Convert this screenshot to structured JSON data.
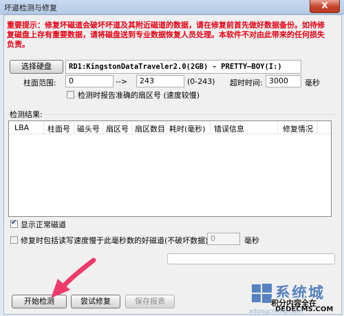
{
  "window": {
    "title": "坏道检测与修复",
    "close_label": "X"
  },
  "warning": "重要提示：修复坏磁道会破坏坏道及其附近磁道的数据，请在修复前首先做好数据备份。如待修复磁盘上存有重要数据，请将磁盘送到专业数据恢复人员处理。本软件不对由此带来的任何损失负责。",
  "disk": {
    "select_label": "选择硬盘",
    "selected": "RD1:KingstonDataTraveler2.0(2GB) - PRETTY—BOY(I:)"
  },
  "range": {
    "label": "柱面范围:",
    "from": "0",
    "arrow": "-->",
    "to": "243",
    "hint": "(0-243)"
  },
  "timeout": {
    "label": "超时时间:",
    "value": "3000",
    "unit": "毫秒"
  },
  "report_sector": {
    "label": "检测时报告准确的扇区号 (速度较慢)",
    "checked": false
  },
  "results": {
    "label": "检测结果:",
    "columns": [
      "LBA",
      "柱面号",
      "磁头号",
      "扇区号",
      "扇区数目",
      "耗时(毫秒)",
      "错误信息",
      "修复情况"
    ]
  },
  "show_normal": {
    "label": "显示正常磁道",
    "checked": true
  },
  "repair_slow": {
    "label": "修复时包括读写速度慢于此毫秒数的好磁道(不破坏数据):",
    "value": "0",
    "unit": "毫秒",
    "checked": false
  },
  "progress": {
    "fraction": 0
  },
  "buttons": {
    "start": "开始检测",
    "repair": "尝试修复",
    "save": "保存报表"
  },
  "watermark": {
    "brand": "系统城",
    "tagline": "积分内容全在",
    "url": "DEDECMS.COM",
    "site": "xitongcheng.com"
  },
  "colors": {
    "warning": "#e60012",
    "arrow": "#ef3b6a"
  }
}
